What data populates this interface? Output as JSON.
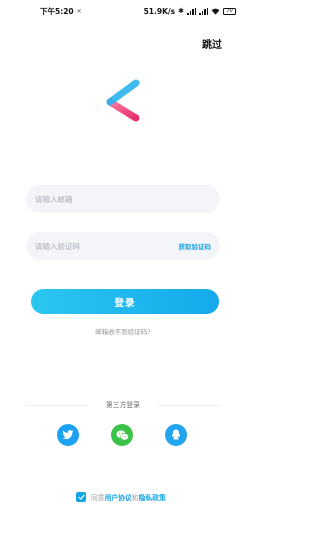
{
  "status_bar": {
    "time": "下午5:20",
    "icon_left": "✕",
    "net_speed": "51.9K/s",
    "battery": "70"
  },
  "header": {
    "skip_label": "跳过"
  },
  "form": {
    "email_placeholder": "请输入邮箱",
    "code_placeholder": "请输入验证码",
    "get_code_label": "获取验证码",
    "login_label": "登录",
    "no_code_label": "邮箱收不到验证码?"
  },
  "third_party": {
    "title": "第三方登录",
    "providers": [
      "twitter",
      "wechat",
      "qq"
    ]
  },
  "agreement": {
    "prefix": "同意",
    "user_agreement": "用户协议",
    "and": "和",
    "privacy_policy": "隐私政策",
    "checked": true
  },
  "colors": {
    "accent": "#16a5e8",
    "button_start": "#2bc7f0",
    "button_end": "#15a9ec",
    "wechat": "#3cc24a",
    "twitter": "#1da1f2",
    "logo_blue": "#1aa7e6",
    "logo_pink": "#f0457e"
  }
}
